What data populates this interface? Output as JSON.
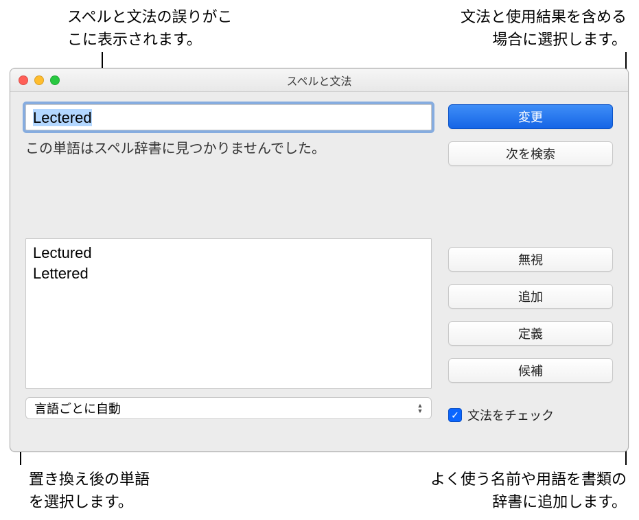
{
  "callouts": {
    "topLeft": "スペルと文法の誤りがこ\nこに表示されます。",
    "topRight": "文法と使用結果を含める\n場合に選択します。",
    "bottomLeft": "置き換え後の単語\nを選択します。",
    "bottomRight": "よく使う名前や用語を書類の\n辞書に追加します。"
  },
  "window": {
    "title": "スペルと文法",
    "misspelled": "Lectered",
    "message": "この単語はスペル辞書に見つかりませんでした。",
    "suggestions": [
      "Lectured",
      "Lettered"
    ],
    "language": "言語ごとに自動",
    "checkGrammarLabel": "文法をチェック",
    "buttons": {
      "change": "変更",
      "findNext": "次を検索",
      "ignore": "無視",
      "learn": "追加",
      "define": "定義",
      "guesses": "候補"
    }
  }
}
